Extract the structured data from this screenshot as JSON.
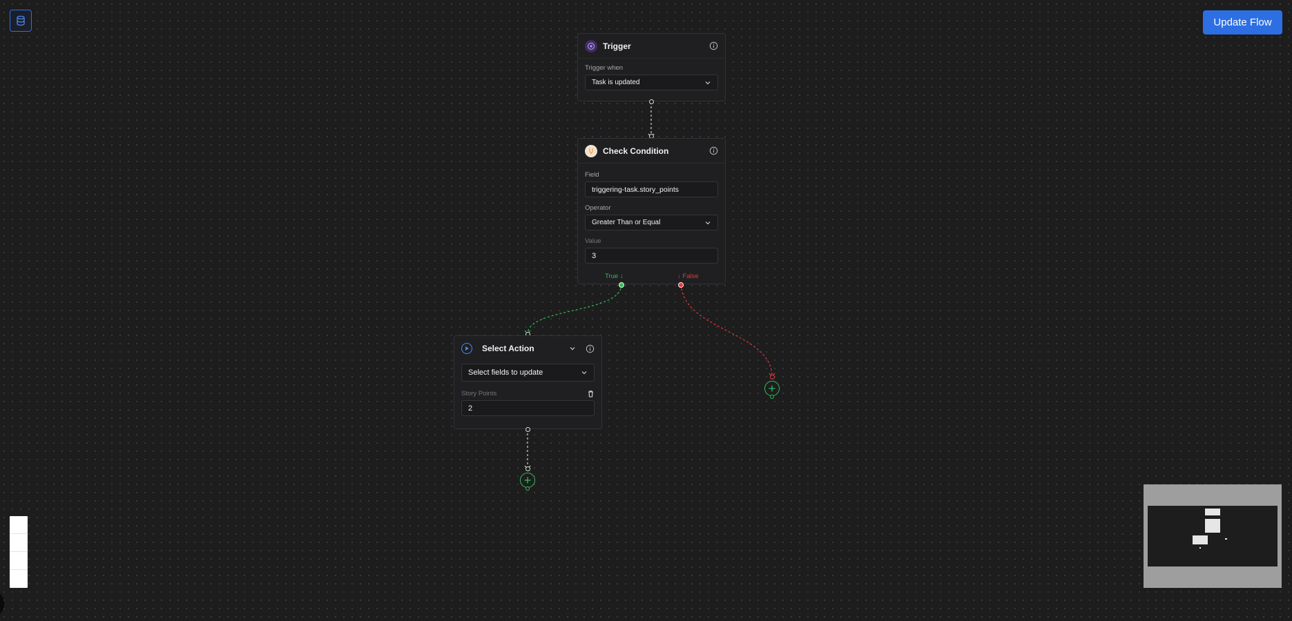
{
  "toolbar": {
    "db_icon": "database-icon",
    "update_label": "Update Flow"
  },
  "trigger": {
    "title": "Trigger",
    "icon": "trigger-icon",
    "trigger_when_label": "Trigger when",
    "trigger_when_value": "Task is updated"
  },
  "condition": {
    "title": "Check Condition",
    "icon": "condition-icon",
    "field_label": "Field",
    "field_value": "triggering-task.story_points",
    "operator_label": "Operator",
    "operator_value": "Greater Than or Equal",
    "value_label": "Value",
    "value_value": "3",
    "true_label": "True ↓",
    "false_label": "↓ False"
  },
  "action": {
    "title": "Select Action",
    "icon": "play-icon",
    "fields_select": "Select fields to update",
    "story_points_label": "Story Points",
    "story_points_value": "2"
  },
  "colors": {
    "accent": "#2d6fe3",
    "true": "#2fbf5a",
    "false": "#e23b3b",
    "trigger_icon": "#b388ff",
    "condition_icon": "#f5a04a"
  }
}
